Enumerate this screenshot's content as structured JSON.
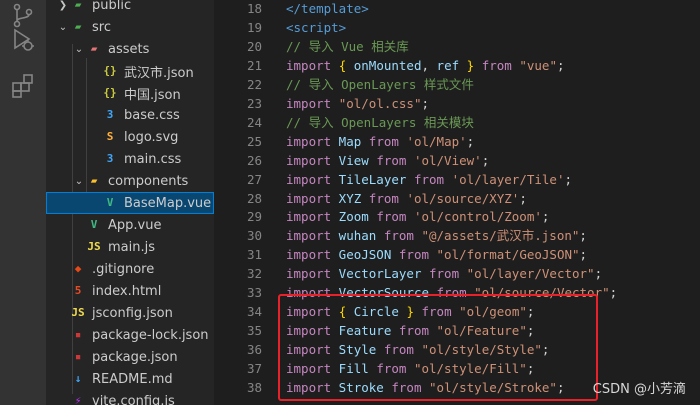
{
  "activity_bar": {
    "icons": [
      "source-control-icon",
      "run-debug-icon",
      "extensions-icon"
    ]
  },
  "explorer": {
    "items": [
      {
        "label": "public",
        "icon": "folder-public-icon",
        "chevron": ">",
        "depth": 0,
        "color": "#4caf50"
      },
      {
        "label": "src",
        "icon": "folder-src-icon",
        "chevron": "v",
        "depth": 0,
        "color": "#4caf50"
      },
      {
        "label": "assets",
        "icon": "folder-assets-icon",
        "chevron": "v",
        "depth": 1,
        "color": "#e57373"
      },
      {
        "label": "武汉市.json",
        "icon": "json-icon",
        "chevron": "",
        "depth": 2,
        "color": "#cbcb41"
      },
      {
        "label": "中国.json",
        "icon": "json-icon",
        "chevron": "",
        "depth": 2,
        "color": "#cbcb41"
      },
      {
        "label": "base.css",
        "icon": "css-icon",
        "chevron": "",
        "depth": 2,
        "color": "#42a5f5"
      },
      {
        "label": "logo.svg",
        "icon": "svg-icon",
        "chevron": "",
        "depth": 2,
        "color": "#ffb13b"
      },
      {
        "label": "main.css",
        "icon": "css-icon",
        "chevron": "",
        "depth": 2,
        "color": "#42a5f5"
      },
      {
        "label": "components",
        "icon": "folder-components-icon",
        "chevron": "v",
        "depth": 1,
        "color": "#fbc02d"
      },
      {
        "label": "BaseMap.vue",
        "icon": "vue-icon",
        "chevron": "",
        "depth": 2,
        "color": "#41b883",
        "selected": true
      },
      {
        "label": "App.vue",
        "icon": "vue-icon",
        "chevron": "",
        "depth": 1,
        "color": "#41b883"
      },
      {
        "label": "main.js",
        "icon": "js-icon",
        "chevron": "",
        "depth": 1,
        "color": "#f0db4f"
      },
      {
        "label": ".gitignore",
        "icon": "git-icon",
        "chevron": "",
        "depth": 0,
        "color": "#e64a19"
      },
      {
        "label": "index.html",
        "icon": "html-icon",
        "chevron": "",
        "depth": 0,
        "color": "#e44d26"
      },
      {
        "label": "jsconfig.json",
        "icon": "jsconfig-icon",
        "chevron": "",
        "depth": 0,
        "color": "#f0db4f"
      },
      {
        "label": "package-lock.json",
        "icon": "npm-icon",
        "chevron": "",
        "depth": 0,
        "color": "#cb3837"
      },
      {
        "label": "package.json",
        "icon": "npm-icon",
        "chevron": "",
        "depth": 0,
        "color": "#cb3837"
      },
      {
        "label": "README.md",
        "icon": "readme-icon",
        "chevron": "",
        "depth": 0,
        "color": "#42a5f5"
      },
      {
        "label": "vite.config.js",
        "icon": "vite-icon",
        "chevron": "",
        "depth": 0,
        "color": "#bd34fe"
      }
    ]
  },
  "editor": {
    "lines": [
      {
        "num": "18",
        "tokens": [
          [
            "tag",
            "</template>"
          ]
        ]
      },
      {
        "num": "19",
        "tokens": [
          [
            "tag",
            "<script>"
          ]
        ]
      },
      {
        "num": "20",
        "tokens": [
          [
            "cm",
            "// 导入 Vue 相关库"
          ]
        ]
      },
      {
        "num": "21",
        "tokens": [
          [
            "kw",
            "import"
          ],
          [
            "pun",
            " "
          ],
          [
            "brc",
            "{"
          ],
          [
            "var",
            " onMounted"
          ],
          [
            "pun",
            ", "
          ],
          [
            "var",
            "ref"
          ],
          [
            "pun",
            " "
          ],
          [
            "brc",
            "}"
          ],
          [
            "pun",
            " "
          ],
          [
            "kw",
            "from"
          ],
          [
            "pun",
            " "
          ],
          [
            "str",
            "\"vue\""
          ],
          [
            "pun",
            ";"
          ]
        ]
      },
      {
        "num": "22",
        "tokens": [
          [
            "cm",
            "// 导入 OpenLayers 样式文件"
          ]
        ]
      },
      {
        "num": "23",
        "tokens": [
          [
            "kw",
            "import"
          ],
          [
            "pun",
            " "
          ],
          [
            "str",
            "\"ol/ol.css\""
          ],
          [
            "pun",
            ";"
          ]
        ]
      },
      {
        "num": "24",
        "tokens": [
          [
            "cm",
            "// 导入 OpenLayers 相关模块"
          ]
        ]
      },
      {
        "num": "25",
        "tokens": [
          [
            "kw",
            "import"
          ],
          [
            "var",
            " Map "
          ],
          [
            "kw",
            "from"
          ],
          [
            "pun",
            " "
          ],
          [
            "str",
            "'ol/Map'"
          ],
          [
            "pun",
            ";"
          ]
        ]
      },
      {
        "num": "26",
        "tokens": [
          [
            "kw",
            "import"
          ],
          [
            "var",
            " View "
          ],
          [
            "kw",
            "from"
          ],
          [
            "pun",
            " "
          ],
          [
            "str",
            "'ol/View'"
          ],
          [
            "pun",
            ";"
          ]
        ]
      },
      {
        "num": "27",
        "tokens": [
          [
            "kw",
            "import"
          ],
          [
            "var",
            " TileLayer "
          ],
          [
            "kw",
            "from"
          ],
          [
            "pun",
            " "
          ],
          [
            "str",
            "'ol/layer/Tile'"
          ],
          [
            "pun",
            ";"
          ]
        ]
      },
      {
        "num": "28",
        "tokens": [
          [
            "kw",
            "import"
          ],
          [
            "var",
            " XYZ "
          ],
          [
            "kw",
            "from"
          ],
          [
            "pun",
            " "
          ],
          [
            "str",
            "'ol/source/XYZ'"
          ],
          [
            "pun",
            ";"
          ]
        ]
      },
      {
        "num": "29",
        "tokens": [
          [
            "kw",
            "import"
          ],
          [
            "var",
            " Zoom "
          ],
          [
            "kw",
            "from"
          ],
          [
            "pun",
            " "
          ],
          [
            "str",
            "'ol/control/Zoom'"
          ],
          [
            "pun",
            ";"
          ]
        ]
      },
      {
        "num": "30",
        "tokens": [
          [
            "kw",
            "import"
          ],
          [
            "var",
            " wuhan "
          ],
          [
            "kw",
            "from"
          ],
          [
            "pun",
            " "
          ],
          [
            "str",
            "\"@/assets/武汉市.json\""
          ],
          [
            "pun",
            ";"
          ]
        ]
      },
      {
        "num": "31",
        "tokens": [
          [
            "kw",
            "import"
          ],
          [
            "var",
            " GeoJSON "
          ],
          [
            "kw",
            "from"
          ],
          [
            "pun",
            " "
          ],
          [
            "str",
            "\"ol/format/GeoJSON\""
          ],
          [
            "pun",
            ";"
          ]
        ]
      },
      {
        "num": "32",
        "tokens": [
          [
            "kw",
            "import"
          ],
          [
            "var",
            " VectorLayer "
          ],
          [
            "kw",
            "from"
          ],
          [
            "pun",
            " "
          ],
          [
            "str",
            "\"ol/layer/Vector\""
          ],
          [
            "pun",
            ";"
          ]
        ]
      },
      {
        "num": "33",
        "tokens": [
          [
            "kw",
            "import"
          ],
          [
            "var",
            " VectorSource "
          ],
          [
            "kw",
            "from"
          ],
          [
            "pun",
            " "
          ],
          [
            "str",
            "\"ol/source/Vector\""
          ],
          [
            "pun",
            ";"
          ]
        ]
      },
      {
        "num": "34",
        "tokens": [
          [
            "kw",
            "import"
          ],
          [
            "pun",
            " "
          ],
          [
            "brc",
            "{"
          ],
          [
            "var",
            " Circle "
          ],
          [
            "brc",
            "}"
          ],
          [
            "pun",
            " "
          ],
          [
            "kw",
            "from"
          ],
          [
            "pun",
            " "
          ],
          [
            "str",
            "\"ol/geom\""
          ],
          [
            "pun",
            ";"
          ]
        ]
      },
      {
        "num": "35",
        "tokens": [
          [
            "kw",
            "import"
          ],
          [
            "var",
            " Feature "
          ],
          [
            "kw",
            "from"
          ],
          [
            "pun",
            " "
          ],
          [
            "str",
            "\"ol/Feature\""
          ],
          [
            "pun",
            ";"
          ]
        ]
      },
      {
        "num": "36",
        "tokens": [
          [
            "kw",
            "import"
          ],
          [
            "var",
            " Style "
          ],
          [
            "kw",
            "from"
          ],
          [
            "pun",
            " "
          ],
          [
            "str",
            "\"ol/style/Style\""
          ],
          [
            "pun",
            ";"
          ]
        ]
      },
      {
        "num": "37",
        "tokens": [
          [
            "kw",
            "import"
          ],
          [
            "var",
            " Fill "
          ],
          [
            "kw",
            "from"
          ],
          [
            "pun",
            " "
          ],
          [
            "str",
            "\"ol/style/Fill\""
          ],
          [
            "pun",
            ";"
          ]
        ]
      },
      {
        "num": "38",
        "tokens": [
          [
            "kw",
            "import"
          ],
          [
            "var",
            " Stroke "
          ],
          [
            "kw",
            "from"
          ],
          [
            "pun",
            " "
          ],
          [
            "str",
            "\"ol/style/Stroke\""
          ],
          [
            "pun",
            ";"
          ]
        ]
      }
    ]
  },
  "watermark": "CSDN @小芳滴",
  "colors": {
    "highlight_box": "#e8222a",
    "selection": "#094771"
  }
}
